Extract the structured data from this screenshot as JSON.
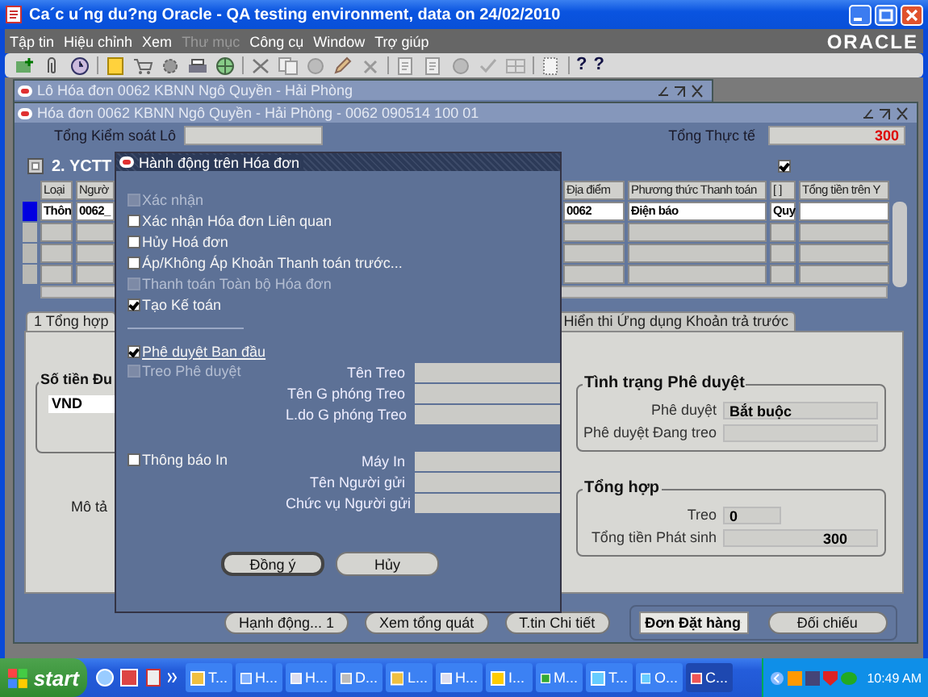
{
  "window": {
    "title": "Ca´c u´ng du?ng Oracle - QA testing environment, data on 24/02/2010"
  },
  "menu": [
    {
      "label": "Tập tin",
      "disabled": false
    },
    {
      "label": "Hiệu chỉnh",
      "disabled": false
    },
    {
      "label": "Xem",
      "disabled": false
    },
    {
      "label": "Thư mục",
      "disabled": true
    },
    {
      "label": "Công cụ",
      "disabled": false
    },
    {
      "label": "Window",
      "disabled": false
    },
    {
      "label": "Trợ giúp",
      "disabled": false
    }
  ],
  "brand": "ORACLE",
  "toolbar_help": [
    "?",
    "?"
  ],
  "batch_window": {
    "title": "Lô Hóa đơn 0062 KBNN Ngô Quyền - Hải Phòng"
  },
  "invoice_window": {
    "title": "Hóa đơn 0062 KBNN Ngô Quyền - Hải Phòng - 0062 090514 100 01",
    "control_total_label": "Tổng Kiểm soát Lô",
    "actual_total_label": "Tổng Thực tế",
    "actual_total": "300",
    "block_title": "2. YCTT",
    "block_checked": true,
    "columns": [
      "Loại",
      "Ngườ",
      "Địa điểm",
      "Phương thức Thanh toán",
      "[ ]",
      "Tổng tiền trên Y"
    ],
    "rows": [
      {
        "selected": true,
        "cells": [
          "Thôn",
          "0062_",
          "0062",
          "Điện báo",
          "Quy"
        ]
      }
    ],
    "tabs": [
      {
        "label": "1 Tổng hợp",
        "selected": true
      },
      {
        "label": "Hiển thi Ứng dụng Khoản trả trước",
        "selected": false
      }
    ],
    "amount_group": {
      "title": "Số tiền Đu",
      "currency": "VND"
    },
    "description_label": "Mô tả",
    "approval_group": {
      "title": "Tình trạng Phê duyệt",
      "fields": [
        {
          "label": "Phê duyệt",
          "value": "Bắt buộc"
        },
        {
          "label": "Phê duyệt Đang treo"
        }
      ]
    },
    "summary_group": {
      "title": "Tổng hợp",
      "fields": [
        {
          "label": "Treo",
          "value": "0"
        },
        {
          "label": "Tổng tiền Phát sinh",
          "value": "300"
        }
      ]
    },
    "buttons": [
      {
        "label": "Hạnh động... 1",
        "kind": "button"
      },
      {
        "label": "Xem tổng quát",
        "kind": "button"
      },
      {
        "label": "T.tin Chi tiết",
        "kind": "button"
      },
      {
        "label": "Đơn Đặt hàng",
        "kind": "dropdown"
      },
      {
        "label": "Đối chiếu",
        "kind": "button"
      }
    ]
  },
  "dialog": {
    "title": "Hành động trên Hóa đơn",
    "actions": [
      {
        "label": "Xác nhận",
        "checked": false,
        "disabled": true
      },
      {
        "label": "Xác nhận Hóa đơn Liên quan",
        "checked": false,
        "disabled": false
      },
      {
        "label": "Hủy Hoá đơn",
        "checked": false,
        "disabled": false
      },
      {
        "label": "Áp/Không Áp Khoản Thanh toán trước...",
        "checked": false,
        "disabled": false
      },
      {
        "label": "Thanh toán Toàn bộ Hóa đơn",
        "checked": false,
        "disabled": true
      },
      {
        "label": "Tạo Kế toán",
        "checked": true,
        "disabled": false
      }
    ],
    "approval": [
      {
        "label": "Phê duyệt Ban đầu",
        "checked": true,
        "disabled": false
      },
      {
        "label": "Treo Phê duyệt",
        "checked": false,
        "disabled": true
      }
    ],
    "hold_fields": [
      "Tên Treo",
      "Tên G phóng Treo",
      "L.do G phóng Treo"
    ],
    "notify": {
      "label": "Thông báo In",
      "checked": false,
      "disabled": false
    },
    "notify_fields": [
      "Máy In",
      "Tên Người gửi",
      "Chức vụ Người gửi"
    ],
    "buttons": [
      "Đồng ý",
      "Hủy"
    ]
  },
  "taskbar": {
    "start": "start",
    "tasks": [
      {
        "label": "T...",
        "selected": false
      },
      {
        "label": "H...",
        "selected": false
      },
      {
        "label": "H...",
        "selected": false
      },
      {
        "label": "D...",
        "selected": false
      },
      {
        "label": "L...",
        "selected": false
      },
      {
        "label": "H...",
        "selected": false
      },
      {
        "label": "I...",
        "selected": false
      },
      {
        "label": "M...",
        "selected": false
      },
      {
        "label": "T...",
        "selected": false
      },
      {
        "label": "O...",
        "selected": false
      },
      {
        "label": "C...",
        "selected": true
      }
    ],
    "clock": "10:49 AM"
  }
}
